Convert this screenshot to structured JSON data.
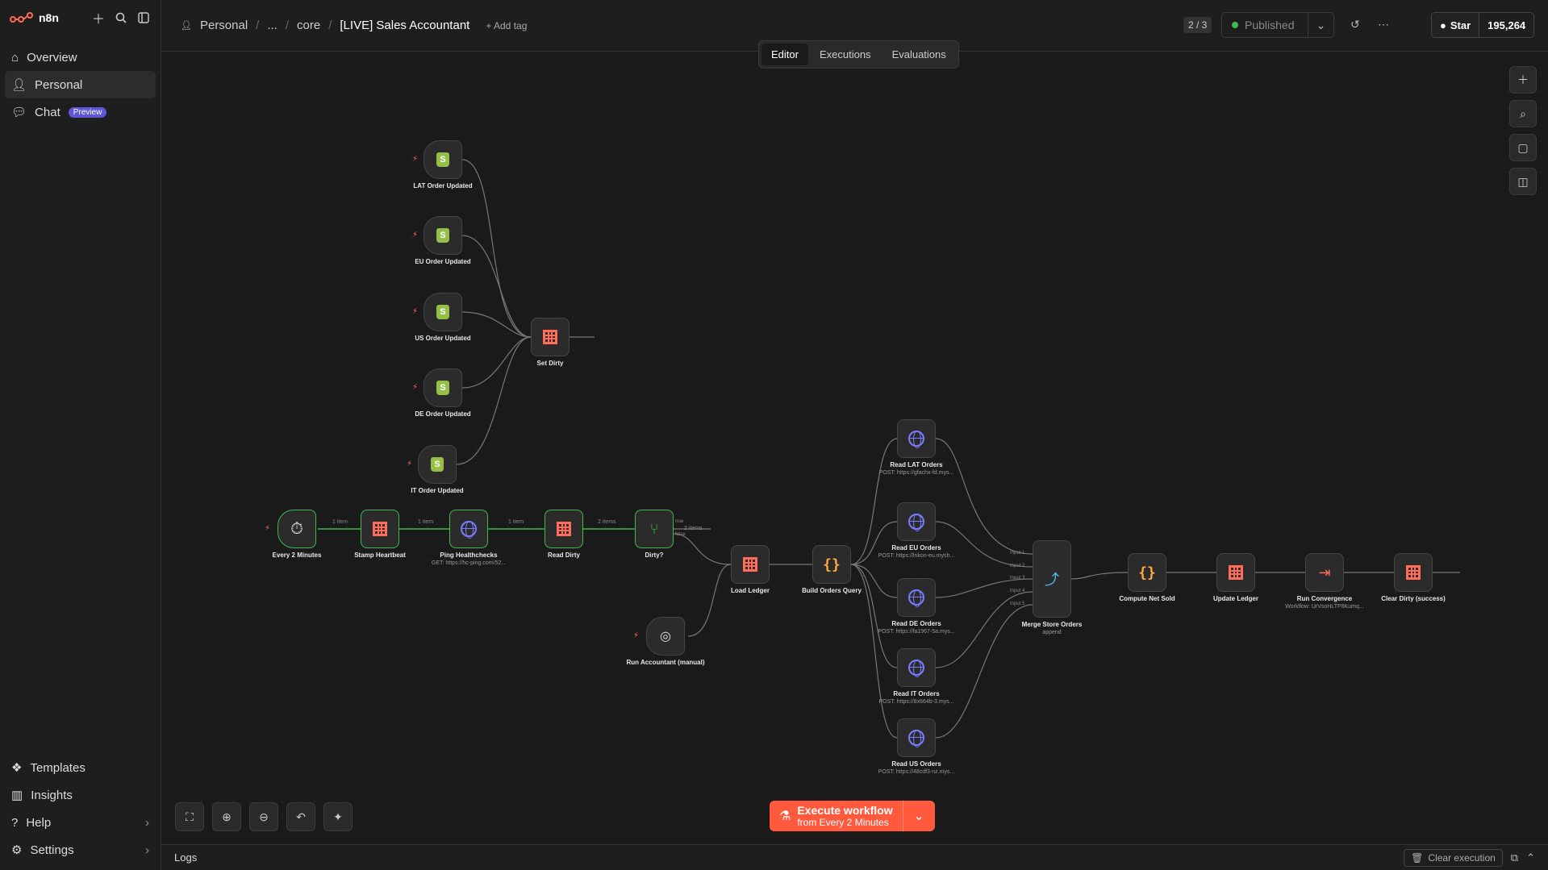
{
  "app": {
    "logo": "n8n"
  },
  "sidebar": {
    "items": [
      {
        "label": "Overview"
      },
      {
        "label": "Personal"
      },
      {
        "label": "Chat",
        "badge": "Preview"
      }
    ],
    "bottom": [
      {
        "label": "Templates"
      },
      {
        "label": "Insights"
      },
      {
        "label": "Help"
      },
      {
        "label": "Settings"
      }
    ]
  },
  "header": {
    "crumbs": [
      "Personal",
      "...",
      "core"
    ],
    "title": "[LIVE] Sales Accountant",
    "add_tag": "+ Add tag",
    "counter": "2 / 3",
    "published": "Published",
    "star": "Star",
    "star_count": "195,264"
  },
  "tabs": [
    "Editor",
    "Executions",
    "Evaluations"
  ],
  "nodes": {
    "lat_trigger": "LAT Order Updated",
    "eu_trigger": "EU Order Updated",
    "us_trigger": "US Order Updated",
    "de_trigger": "DE Order Updated",
    "it_trigger": "IT Order Updated",
    "set_dirty": "Set Dirty",
    "every2": "Every 2 Minutes",
    "stamp": "Stamp Heartbeat",
    "ping": "Ping Healthchecks",
    "ping_sub": "GET: https://hc-ping.com/52...",
    "read_dirty": "Read Dirty",
    "dirty": "Dirty?",
    "run_manual": "Run Accountant (manual)",
    "load_ledger": "Load Ledger",
    "build_query": "Build Orders Query",
    "read_lat": "Read LAT Orders",
    "read_lat_sub": "POST: https://gfachx-fd.mys...",
    "read_eu": "Read EU Orders",
    "read_eu_sub": "POST: https://lnkon-eu.mysh...",
    "read_de": "Read DE Orders",
    "read_de_sub": "POST: https://fa1967-5a.mys...",
    "read_it": "Read IT Orders",
    "read_it_sub": "POST: https://8x664b-3.mys...",
    "read_us": "Read US Orders",
    "read_us_sub": "POST: https://48cdf3-nz.mys...",
    "merge": "Merge Store Orders",
    "merge_sub": "append",
    "compute": "Compute Net Sold",
    "update_ledger": "Update Ledger",
    "convergence": "Run Convergence",
    "convergence_sub": "Workflow: UrVsoHLTP8Kumq...",
    "clear_dirty": "Clear Dirty (success)"
  },
  "edges": {
    "e1": "1 item",
    "e2": "1 item",
    "e3": "1 item",
    "e4": "2 items",
    "e5": "2 items",
    "true": "true",
    "false": "false",
    "in1": "Input 1",
    "in2": "Input 2",
    "in3": "Input 3",
    "in4": "Input 4",
    "in5": "Input 5"
  },
  "execute": {
    "label": "Execute workflow",
    "sub": "from Every 2 Minutes"
  },
  "logs": {
    "label": "Logs",
    "clear": "Clear execution"
  }
}
